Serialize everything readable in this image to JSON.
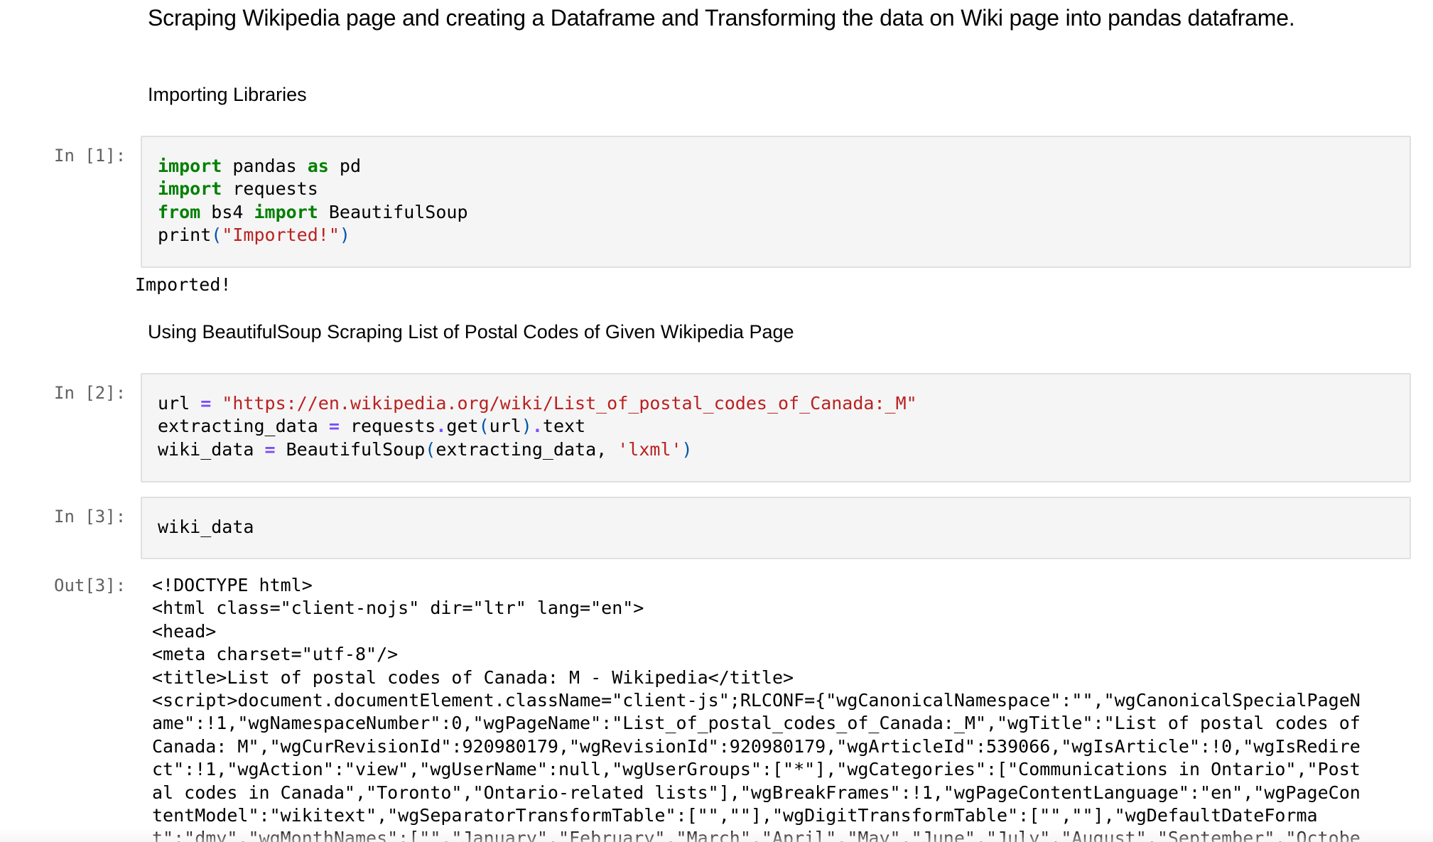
{
  "markdown": {
    "heading": "Scraping Wikipedia page and creating a Dataframe and Transforming the data on Wiki page into pandas dataframe.",
    "importing": "Importing Libraries",
    "using_bs": "Using BeautifulSoup Scraping List of Postal Codes of Given Wikipedia Page"
  },
  "cells": {
    "c1": {
      "prompt": "In [1]:",
      "output": "Imported!"
    },
    "c2": {
      "prompt": "In [2]:"
    },
    "c3": {
      "prompt": "In [3]:",
      "out_prompt": "Out[3]:"
    }
  },
  "code": {
    "c1": {
      "import": "import",
      "pandas": " pandas ",
      "as": "as",
      "pd": " pd",
      "import2": "import",
      "requests": " requests",
      "from": "from",
      "bs4": " bs4 ",
      "import3": "import",
      "bs": " BeautifulSoup",
      "print": "print",
      "lp": "(",
      "str": "\"Imported!\"",
      "rp": ")"
    },
    "c2": {
      "url": "url ",
      "eq1": "=",
      "urlstr": " \"https://en.wikipedia.org/wiki/List_of_postal_codes_of_Canada:_M\"",
      "ext": "extracting_data ",
      "eq2": "=",
      "req": " requests",
      "dot1": ".",
      "get": "get",
      "lp1": "(",
      "urlarg": "url",
      "rp1": ")",
      "dot2": ".",
      "text": "text",
      "wiki": "wiki_data ",
      "eq3": "=",
      "bsc": " BeautifulSoup",
      "lp2": "(",
      "arg": "extracting_data, ",
      "lxml": "'lxml'",
      "rp2": ")"
    },
    "c3": {
      "line": "wiki_data"
    }
  },
  "output_html": [
    "<!DOCTYPE html>",
    "<html class=\"client-nojs\" dir=\"ltr\" lang=\"en\">",
    "<head>",
    "<meta charset=\"utf-8\"/>",
    "<title>List of postal codes of Canada: M - Wikipedia</title>",
    "<script>document.documentElement.className=\"client-js\";RLCONF={\"wgCanonicalNamespace\":\"\",\"wgCanonicalSpecialPageN",
    "ame\":!1,\"wgNamespaceNumber\":0,\"wgPageName\":\"List_of_postal_codes_of_Canada:_M\",\"wgTitle\":\"List of postal codes of",
    "Canada: M\",\"wgCurRevisionId\":920980179,\"wgRevisionId\":920980179,\"wgArticleId\":539066,\"wgIsArticle\":!0,\"wgIsRedire",
    "ct\":!1,\"wgAction\":\"view\",\"wgUserName\":null,\"wgUserGroups\":[\"*\"],\"wgCategories\":[\"Communications in Ontario\",\"Post",
    "al codes in Canada\",\"Toronto\",\"Ontario-related lists\"],\"wgBreakFrames\":!1,\"wgPageContentLanguage\":\"en\",\"wgPageCon",
    "tentModel\":\"wikitext\",\"wgSeparatorTransformTable\":[\"\",\"\"],\"wgDigitTransformTable\":[\"\",\"\"],\"wgDefaultDateForma",
    "t\":\"dmy\",\"wgMonthNames\":[\"\",\"January\",\"February\",\"March\",\"April\",\"May\",\"June\",\"July\",\"August\",\"September\",\"Octobe"
  ]
}
